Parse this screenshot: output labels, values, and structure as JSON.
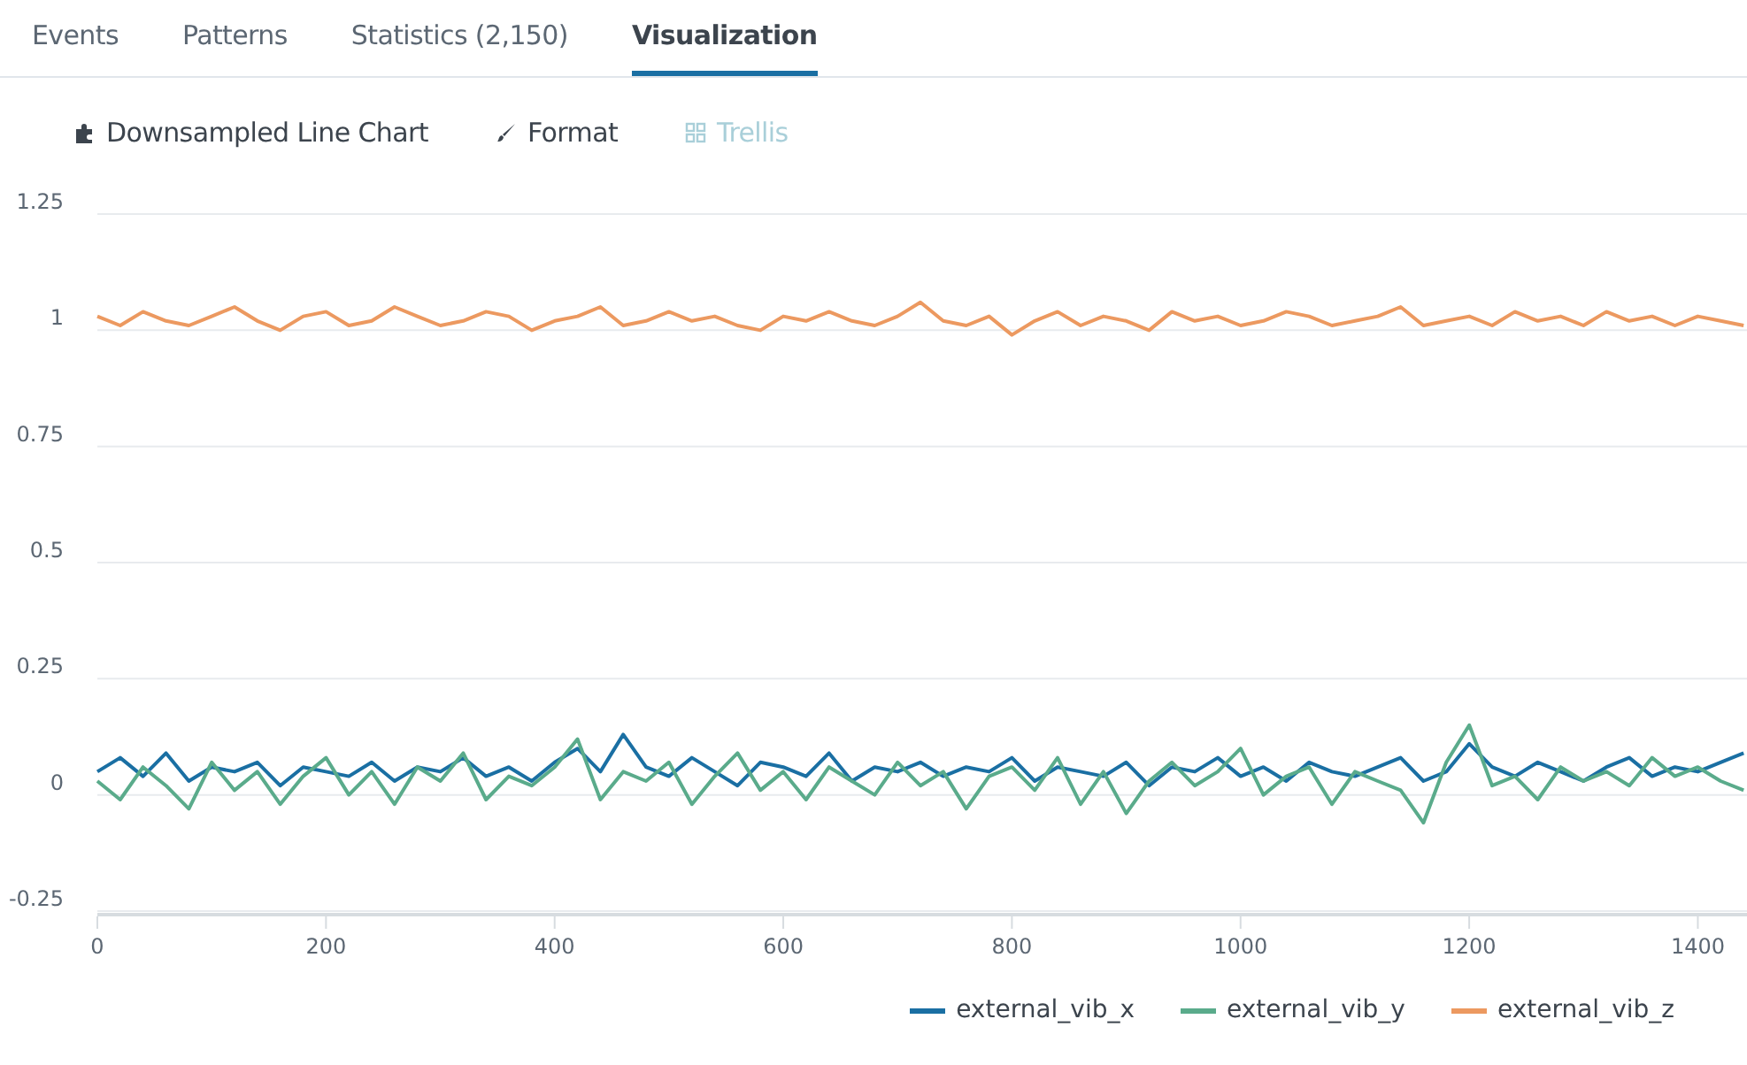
{
  "tabs": [
    {
      "label": "Events",
      "selected": false
    },
    {
      "label": "Patterns",
      "selected": false
    },
    {
      "label": "Statistics (2,150)",
      "selected": false
    },
    {
      "label": "Visualization",
      "selected": true
    }
  ],
  "toolbar": [
    {
      "kind": "chart-type",
      "label": "Downsampled Line Chart",
      "disabled": false
    },
    {
      "kind": "format",
      "label": "Format",
      "disabled": false
    },
    {
      "kind": "trellis",
      "label": "Trellis",
      "disabled": true
    }
  ],
  "chart": {
    "chart_data": {
      "type": "line",
      "grid": true,
      "x": [
        0,
        20,
        40,
        60,
        80,
        100,
        120,
        140,
        160,
        180,
        200,
        220,
        240,
        260,
        280,
        300,
        320,
        340,
        360,
        380,
        400,
        420,
        440,
        460,
        480,
        500,
        520,
        540,
        560,
        580,
        600,
        620,
        640,
        660,
        680,
        700,
        720,
        740,
        760,
        780,
        800,
        820,
        840,
        860,
        880,
        900,
        920,
        940,
        960,
        980,
        1000,
        1020,
        1040,
        1060,
        1080,
        1100,
        1120,
        1140,
        1160,
        1180,
        1200,
        1220,
        1240,
        1260,
        1280,
        1300,
        1320,
        1340,
        1360,
        1380,
        1400,
        1420,
        1440
      ],
      "series": [
        {
          "name": "external_vib_x",
          "color": "#1a6fa3",
          "values": [
            0.05,
            0.08,
            0.04,
            0.09,
            0.03,
            0.06,
            0.05,
            0.07,
            0.02,
            0.06,
            0.05,
            0.04,
            0.07,
            0.03,
            0.06,
            0.05,
            0.08,
            0.04,
            0.06,
            0.03,
            0.07,
            0.1,
            0.05,
            0.13,
            0.06,
            0.04,
            0.08,
            0.05,
            0.02,
            0.07,
            0.06,
            0.04,
            0.09,
            0.03,
            0.06,
            0.05,
            0.07,
            0.04,
            0.06,
            0.05,
            0.08,
            0.03,
            0.06,
            0.05,
            0.04,
            0.07,
            0.02,
            0.06,
            0.05,
            0.08,
            0.04,
            0.06,
            0.03,
            0.07,
            0.05,
            0.04,
            0.06,
            0.08,
            0.03,
            0.05,
            0.11,
            0.06,
            0.04,
            0.07,
            0.05,
            0.03,
            0.06,
            0.08,
            0.04,
            0.06,
            0.05,
            0.07,
            0.09
          ]
        },
        {
          "name": "external_vib_y",
          "color": "#5aab8b",
          "values": [
            0.03,
            -0.01,
            0.06,
            0.02,
            -0.03,
            0.07,
            0.01,
            0.05,
            -0.02,
            0.04,
            0.08,
            0.0,
            0.05,
            -0.02,
            0.06,
            0.03,
            0.09,
            -0.01,
            0.04,
            0.02,
            0.06,
            0.12,
            -0.01,
            0.05,
            0.03,
            0.07,
            -0.02,
            0.04,
            0.09,
            0.01,
            0.05,
            -0.01,
            0.06,
            0.03,
            0.0,
            0.07,
            0.02,
            0.05,
            -0.03,
            0.04,
            0.06,
            0.01,
            0.08,
            -0.02,
            0.05,
            -0.04,
            0.03,
            0.07,
            0.02,
            0.05,
            0.1,
            0.0,
            0.04,
            0.06,
            -0.02,
            0.05,
            0.03,
            0.01,
            -0.06,
            0.07,
            0.15,
            0.02,
            0.04,
            -0.01,
            0.06,
            0.03,
            0.05,
            0.02,
            0.08,
            0.04,
            0.06,
            0.03,
            0.01
          ]
        },
        {
          "name": "external_vib_z",
          "color": "#ec9960",
          "values": [
            1.03,
            1.01,
            1.04,
            1.02,
            1.01,
            1.03,
            1.05,
            1.02,
            1.0,
            1.03,
            1.04,
            1.01,
            1.02,
            1.05,
            1.03,
            1.01,
            1.02,
            1.04,
            1.03,
            1.0,
            1.02,
            1.03,
            1.05,
            1.01,
            1.02,
            1.04,
            1.02,
            1.03,
            1.01,
            1.0,
            1.03,
            1.02,
            1.04,
            1.02,
            1.01,
            1.03,
            1.06,
            1.02,
            1.01,
            1.03,
            0.99,
            1.02,
            1.04,
            1.01,
            1.03,
            1.02,
            1.0,
            1.04,
            1.02,
            1.03,
            1.01,
            1.02,
            1.04,
            1.03,
            1.01,
            1.02,
            1.03,
            1.05,
            1.01,
            1.02,
            1.03,
            1.01,
            1.04,
            1.02,
            1.03,
            1.01,
            1.04,
            1.02,
            1.03,
            1.01,
            1.03,
            1.02,
            1.01
          ]
        }
      ],
      "xlim": [
        0,
        1443
      ],
      "ylim": [
        -0.25,
        1.25
      ],
      "xticks": [
        0,
        200,
        400,
        600,
        800,
        1000,
        1200,
        1400
      ],
      "yticks": [
        -0.25,
        0,
        0.25,
        0.5,
        0.75,
        1,
        1.25
      ]
    }
  }
}
